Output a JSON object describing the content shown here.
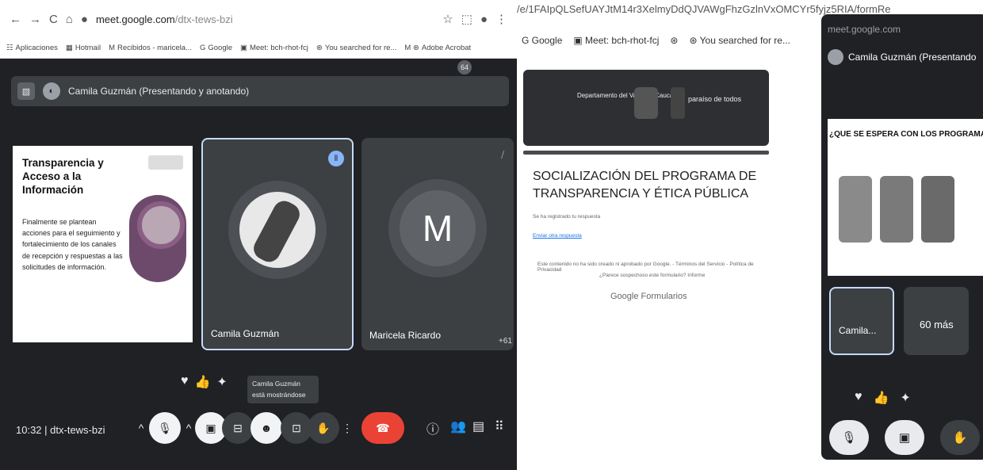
{
  "browser": {
    "url_domain": "meet.google.com",
    "url_path": "/dtx-tews-bzi",
    "bookmarks": [
      "Aplicaciones",
      "Hotmail",
      "Recibidos - maricela...",
      "Google",
      "Meet: bch-rhot-fcj",
      "You searched for re...",
      "Adobe Acrobat"
    ]
  },
  "meet": {
    "presenter_bar": "Camila Guzmán (Presentando y anotando)",
    "slide_title": "Transparencia y Acceso a la Información",
    "slide_body": "Finalmente se plantean acciones para el seguimiento y fortalecimiento de los canales de recepción y respuestas a las solicitudes de información.",
    "tiles": [
      {
        "name": "Camila Guzmán"
      },
      {
        "name": "Maricela Ricardo",
        "initial": "M",
        "extra": "+61"
      }
    ],
    "toast": "Camila Guzmán está mostrándose",
    "time": "10:32",
    "meeting_code": "dtx-tews-bzi",
    "participants_count": "64"
  },
  "form": {
    "url_fragment": "/e/1FAIpQLSefUAYJtM14r3XelmyDdQJVAWgFhzGzlnVxOMCYr5fyjz5RIA/formRe",
    "bookmarks": [
      "Google",
      "Meet: bch-rhot-fcj",
      "You searched for re..."
    ],
    "header_left": "Departamento del Valle del Cauca",
    "header_right": "paraíso de todos",
    "title": "SOCIALIZACIÓN DEL PROGRAMA DE TRANSPARENCIA Y ÉTICA PÚBLICA",
    "confirmation": "Se ha registrado tu respuesta",
    "edit_link": "Enviar otra respuesta",
    "disclaimer": "Este contenido no ha sido creado ni aprobado por Google. - Términos del Servicio - Política de Privacidad",
    "report": "¿Parece sospechoso este formulario? Informe",
    "brand": "Google Formularios"
  },
  "panel": {
    "url": "meet.google.com",
    "presenter": "Camila Guzmán (Presentando",
    "slide_heading": "¿QUE SE ESPERA CON LOS PROGRAMA",
    "tile_name": "Camila...",
    "more": "60 más"
  }
}
